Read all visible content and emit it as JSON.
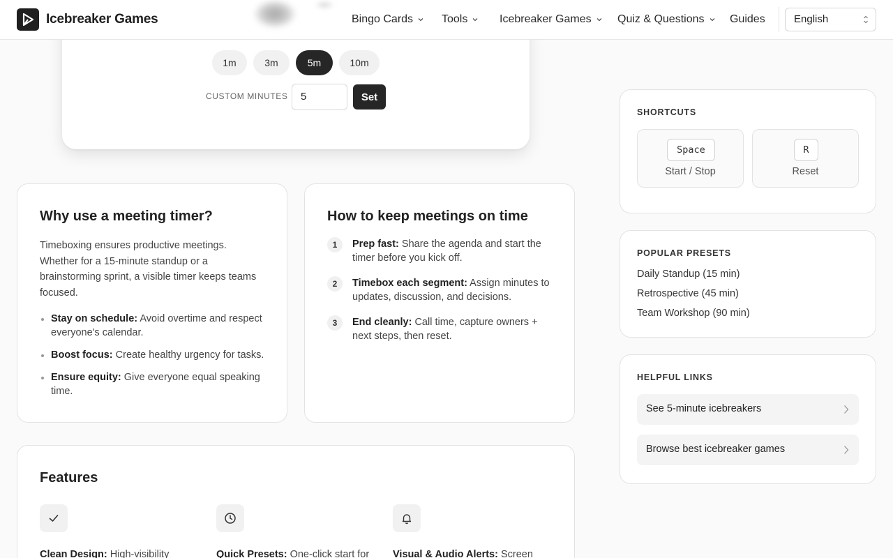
{
  "header": {
    "brand": "Icebreaker Games",
    "nav": [
      {
        "label": "Bingo Cards",
        "has_dropdown": true
      },
      {
        "label": "Tools",
        "has_dropdown": true
      },
      {
        "label": "Icebreaker Games",
        "has_dropdown": true
      },
      {
        "label": "Quiz & Questions",
        "has_dropdown": true
      },
      {
        "label": "Guides",
        "has_dropdown": false
      }
    ],
    "language": "English"
  },
  "timer": {
    "presets": [
      {
        "label": "1m",
        "active": false
      },
      {
        "label": "3m",
        "active": false
      },
      {
        "label": "5m",
        "active": true
      },
      {
        "label": "10m",
        "active": false
      }
    ],
    "custom_label": "CUSTOM MINUTES",
    "custom_value": "5",
    "set_label": "Set"
  },
  "why": {
    "title": "Why use a meeting timer?",
    "body": "Timeboxing ensures productive meetings. Whether for a 15-minute standup or a brainstorming sprint, a visible timer keeps teams focused.",
    "bullets": [
      {
        "bold": "Stay on schedule:",
        "text": " Avoid overtime and respect everyone's calendar."
      },
      {
        "bold": "Boost focus:",
        "text": " Create healthy urgency for tasks."
      },
      {
        "bold": "Ensure equity:",
        "text": " Give everyone equal speaking time."
      }
    ]
  },
  "how": {
    "title": "How to keep meetings on time",
    "steps": [
      {
        "num": "1",
        "bold": "Prep fast:",
        "text": " Share the agenda and start the timer before you kick off."
      },
      {
        "num": "2",
        "bold": "Timebox each segment:",
        "text": " Assign minutes to updates, discussion, and decisions."
      },
      {
        "num": "3",
        "bold": "End cleanly:",
        "text": " Call time, capture owners + next steps, then reset."
      }
    ]
  },
  "features": {
    "title": "Features",
    "items": [
      {
        "icon": "check-icon",
        "bold": "Clean Design:",
        "text": " High-visibility"
      },
      {
        "icon": "clock-icon",
        "bold": "Quick Presets:",
        "text": " One-click start for"
      },
      {
        "icon": "bell-icon",
        "bold": "Visual & Audio Alerts:",
        "text": " Screen"
      }
    ]
  },
  "sidebar": {
    "shortcuts": {
      "title": "SHORTCUTS",
      "items": [
        {
          "key": "Space",
          "label": "Start / Stop"
        },
        {
          "key": "R",
          "label": "Reset"
        }
      ]
    },
    "popular": {
      "title": "POPULAR PRESETS",
      "items": [
        "Daily Standup (15 min)",
        "Retrospective (45 min)",
        "Team Workshop (90 min)"
      ]
    },
    "links": {
      "title": "HELPFUL LINKS",
      "items": [
        "See 5-minute icebreakers",
        "Browse best icebreaker games"
      ]
    }
  }
}
